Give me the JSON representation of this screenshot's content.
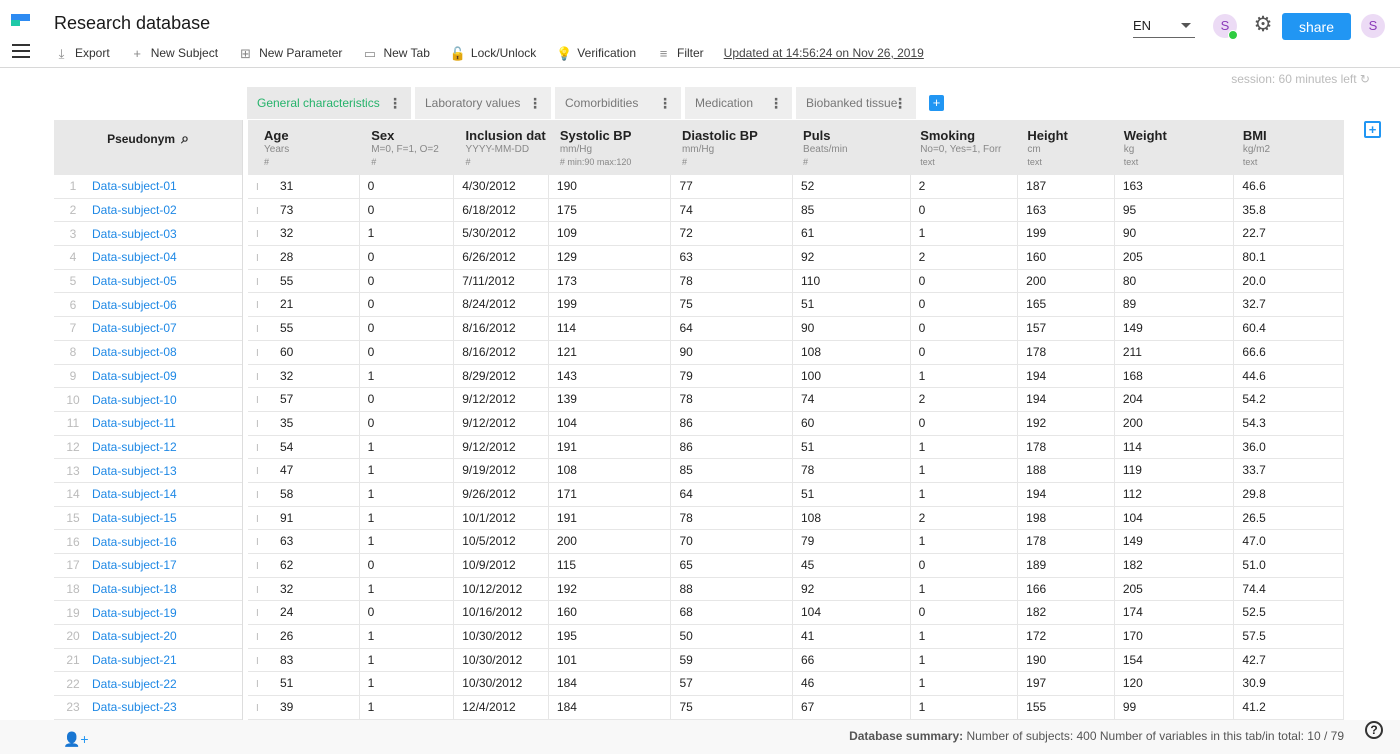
{
  "app": {
    "title": "Research database"
  },
  "toolbar": {
    "items": [
      {
        "label": "Export",
        "icon": "download-icon"
      },
      {
        "label": "New Subject",
        "icon": "add-user-icon"
      },
      {
        "label": "New Parameter",
        "icon": "add-box-icon"
      },
      {
        "label": "New Tab",
        "icon": "tab-icon"
      },
      {
        "label": "Lock/Unlock",
        "icon": "lock-icon"
      },
      {
        "label": "Verification",
        "icon": "lightbulb-icon"
      },
      {
        "label": "Filter",
        "icon": "filter-icon"
      }
    ],
    "updated": "Updated at 14:56:24 on Nov 26, 2019"
  },
  "header_right": {
    "language": "EN",
    "avatar_initial": "S",
    "share_label": "share",
    "user_initial": "S"
  },
  "session": {
    "text": "session: 60 minutes left ↻"
  },
  "tabs": [
    {
      "label": "General characteristics",
      "active": true
    },
    {
      "label": "Laboratory values",
      "active": false
    },
    {
      "label": "Comorbidities",
      "active": false
    },
    {
      "label": "Medication",
      "active": false
    },
    {
      "label": "Biobanked tissue",
      "active": false
    }
  ],
  "pseudonym": {
    "header": "Pseudonym"
  },
  "columns": [
    {
      "title": "Age",
      "unit": "Years",
      "sub": "#"
    },
    {
      "title": "Sex",
      "unit": "M=0, F=1, O=2",
      "sub": "#"
    },
    {
      "title": "Inclusion dat",
      "unit": "YYYY-MM-DD",
      "sub": "#"
    },
    {
      "title": "Systolic BP",
      "unit": "mm/Hg",
      "sub": "# min:90 max:120"
    },
    {
      "title": "Diastolic BP",
      "unit": "mm/Hg",
      "sub": "#"
    },
    {
      "title": "Puls",
      "unit": "Beats/min",
      "sub": "#"
    },
    {
      "title": "Smoking",
      "unit": "No=0, Yes=1, Forr",
      "sub": "text"
    },
    {
      "title": "Height",
      "unit": "cm",
      "sub": "text"
    },
    {
      "title": "Weight",
      "unit": "kg",
      "sub": "text"
    },
    {
      "title": "BMI",
      "unit": "kg/m2",
      "sub": "text"
    }
  ],
  "rows": [
    {
      "n": "1",
      "name": "Data-subject-01",
      "marker": "I",
      "cells": [
        "31",
        "0",
        "4/30/2012",
        "190",
        "77",
        "52",
        "2",
        "187",
        "163",
        "46.6"
      ]
    },
    {
      "n": "2",
      "name": "Data-subject-02",
      "marker": "I",
      "cells": [
        "73",
        "0",
        "6/18/2012",
        "175",
        "74",
        "85",
        "0",
        "163",
        "95",
        "35.8"
      ]
    },
    {
      "n": "3",
      "name": "Data-subject-03",
      "marker": "I",
      "cells": [
        "32",
        "1",
        "5/30/2012",
        "109",
        "72",
        "61",
        "1",
        "199",
        "90",
        "22.7"
      ]
    },
    {
      "n": "4",
      "name": "Data-subject-04",
      "marker": "I",
      "cells": [
        "28",
        "0",
        "6/26/2012",
        "129",
        "63",
        "92",
        "2",
        "160",
        "205",
        "80.1"
      ]
    },
    {
      "n": "5",
      "name": "Data-subject-05",
      "marker": "I",
      "cells": [
        "55",
        "0",
        "7/11/2012",
        "173",
        "78",
        "110",
        "0",
        "200",
        "80",
        "20.0"
      ]
    },
    {
      "n": "6",
      "name": "Data-subject-06",
      "marker": "I",
      "cells": [
        "21",
        "0",
        "8/24/2012",
        "199",
        "75",
        "51",
        "0",
        "165",
        "89",
        "32.7"
      ]
    },
    {
      "n": "7",
      "name": "Data-subject-07",
      "marker": "I",
      "cells": [
        "55",
        "0",
        "8/16/2012",
        "114",
        "64",
        "90",
        "0",
        "157",
        "149",
        "60.4"
      ]
    },
    {
      "n": "8",
      "name": "Data-subject-08",
      "marker": "I",
      "cells": [
        "60",
        "0",
        "8/16/2012",
        "121",
        "90",
        "108",
        "0",
        "178",
        "211",
        "66.6"
      ]
    },
    {
      "n": "9",
      "name": "Data-subject-09",
      "marker": "I",
      "cells": [
        "32",
        "1",
        "8/29/2012",
        "143",
        "79",
        "100",
        "1",
        "194",
        "168",
        "44.6"
      ]
    },
    {
      "n": "10",
      "name": "Data-subject-10",
      "marker": "I",
      "cells": [
        "57",
        "0",
        "9/12/2012",
        "139",
        "78",
        "74",
        "2",
        "194",
        "204",
        "54.2"
      ]
    },
    {
      "n": "11",
      "name": "Data-subject-11",
      "marker": "I",
      "cells": [
        "35",
        "0",
        "9/12/2012",
        "104",
        "86",
        "60",
        "0",
        "192",
        "200",
        "54.3"
      ]
    },
    {
      "n": "12",
      "name": "Data-subject-12",
      "marker": "I",
      "cells": [
        "54",
        "1",
        "9/12/2012",
        "191",
        "86",
        "51",
        "1",
        "178",
        "114",
        "36.0"
      ]
    },
    {
      "n": "13",
      "name": "Data-subject-13",
      "marker": "I",
      "cells": [
        "47",
        "1",
        "9/19/2012",
        "108",
        "85",
        "78",
        "1",
        "188",
        "119",
        "33.7"
      ]
    },
    {
      "n": "14",
      "name": "Data-subject-14",
      "marker": "I",
      "cells": [
        "58",
        "1",
        "9/26/2012",
        "171",
        "64",
        "51",
        "1",
        "194",
        "112",
        "29.8"
      ]
    },
    {
      "n": "15",
      "name": "Data-subject-15",
      "marker": "I",
      "cells": [
        "91",
        "1",
        "10/1/2012",
        "191",
        "78",
        "108",
        "2",
        "198",
        "104",
        "26.5"
      ]
    },
    {
      "n": "16",
      "name": "Data-subject-16",
      "marker": "I",
      "cells": [
        "63",
        "1",
        "10/5/2012",
        "200",
        "70",
        "79",
        "1",
        "178",
        "149",
        "47.0"
      ]
    },
    {
      "n": "17",
      "name": "Data-subject-17",
      "marker": "I",
      "cells": [
        "62",
        "0",
        "10/9/2012",
        "115",
        "65",
        "45",
        "0",
        "189",
        "182",
        "51.0"
      ]
    },
    {
      "n": "18",
      "name": "Data-subject-18",
      "marker": "I",
      "cells": [
        "32",
        "1",
        "10/12/2012",
        "192",
        "88",
        "92",
        "1",
        "166",
        "205",
        "74.4"
      ]
    },
    {
      "n": "19",
      "name": "Data-subject-19",
      "marker": "I",
      "cells": [
        "24",
        "0",
        "10/16/2012",
        "160",
        "68",
        "104",
        "0",
        "182",
        "174",
        "52.5"
      ]
    },
    {
      "n": "20",
      "name": "Data-subject-20",
      "marker": "I",
      "cells": [
        "26",
        "1",
        "10/30/2012",
        "195",
        "50",
        "41",
        "1",
        "172",
        "170",
        "57.5"
      ]
    },
    {
      "n": "21",
      "name": "Data-subject-21",
      "marker": "I",
      "cells": [
        "83",
        "1",
        "10/30/2012",
        "101",
        "59",
        "66",
        "1",
        "190",
        "154",
        "42.7"
      ]
    },
    {
      "n": "22",
      "name": "Data-subject-22",
      "marker": "I",
      "cells": [
        "51",
        "1",
        "10/30/2012",
        "184",
        "57",
        "46",
        "1",
        "197",
        "120",
        "30.9"
      ]
    },
    {
      "n": "23",
      "name": "Data-subject-23",
      "marker": "I",
      "cells": [
        "39",
        "1",
        "12/4/2012",
        "184",
        "75",
        "67",
        "1",
        "155",
        "99",
        "41.2"
      ]
    }
  ],
  "footer": {
    "summary_label": "Database summary:",
    "summary_text": " Number of subjects: 400 Number of variables in this tab/in total: 10 / 79",
    "help": "?"
  }
}
